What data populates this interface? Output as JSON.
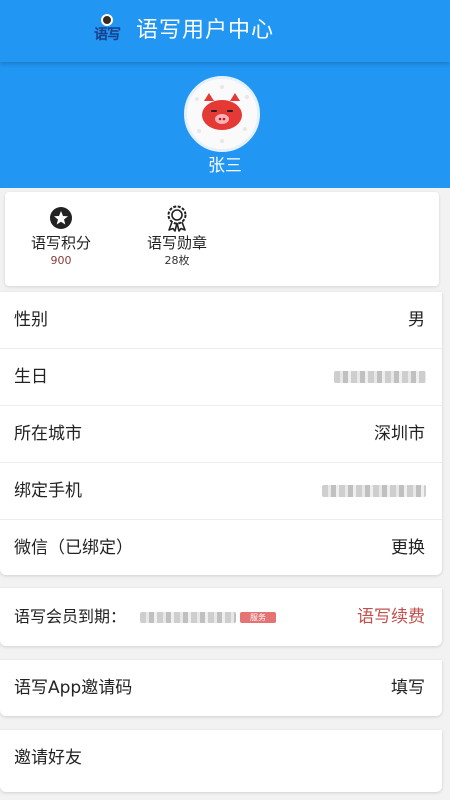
{
  "header": {
    "logo_text": "语写",
    "title": "语写用户中心",
    "background": "#2196f3"
  },
  "profile": {
    "username": "张三"
  },
  "stats": {
    "points": {
      "label": "语写积分",
      "value": "900"
    },
    "badges": {
      "label": "语写勋章",
      "value": "28枚"
    }
  },
  "info": {
    "gender": {
      "label": "性别",
      "value": "男"
    },
    "birthday": {
      "label": "生日"
    },
    "city": {
      "label": "所在城市",
      "value": "深圳市"
    },
    "phone": {
      "label": "绑定手机"
    },
    "wechat": {
      "label": "微信（已绑定）",
      "value": "更换"
    }
  },
  "membership": {
    "label": "语写会员到期：",
    "tag": "服务",
    "action": "语写续费",
    "action_color": "#c0504d"
  },
  "invite_code": {
    "label": "语写App邀请码",
    "action": "填写"
  },
  "invite_friends": {
    "label": "邀请好友"
  }
}
